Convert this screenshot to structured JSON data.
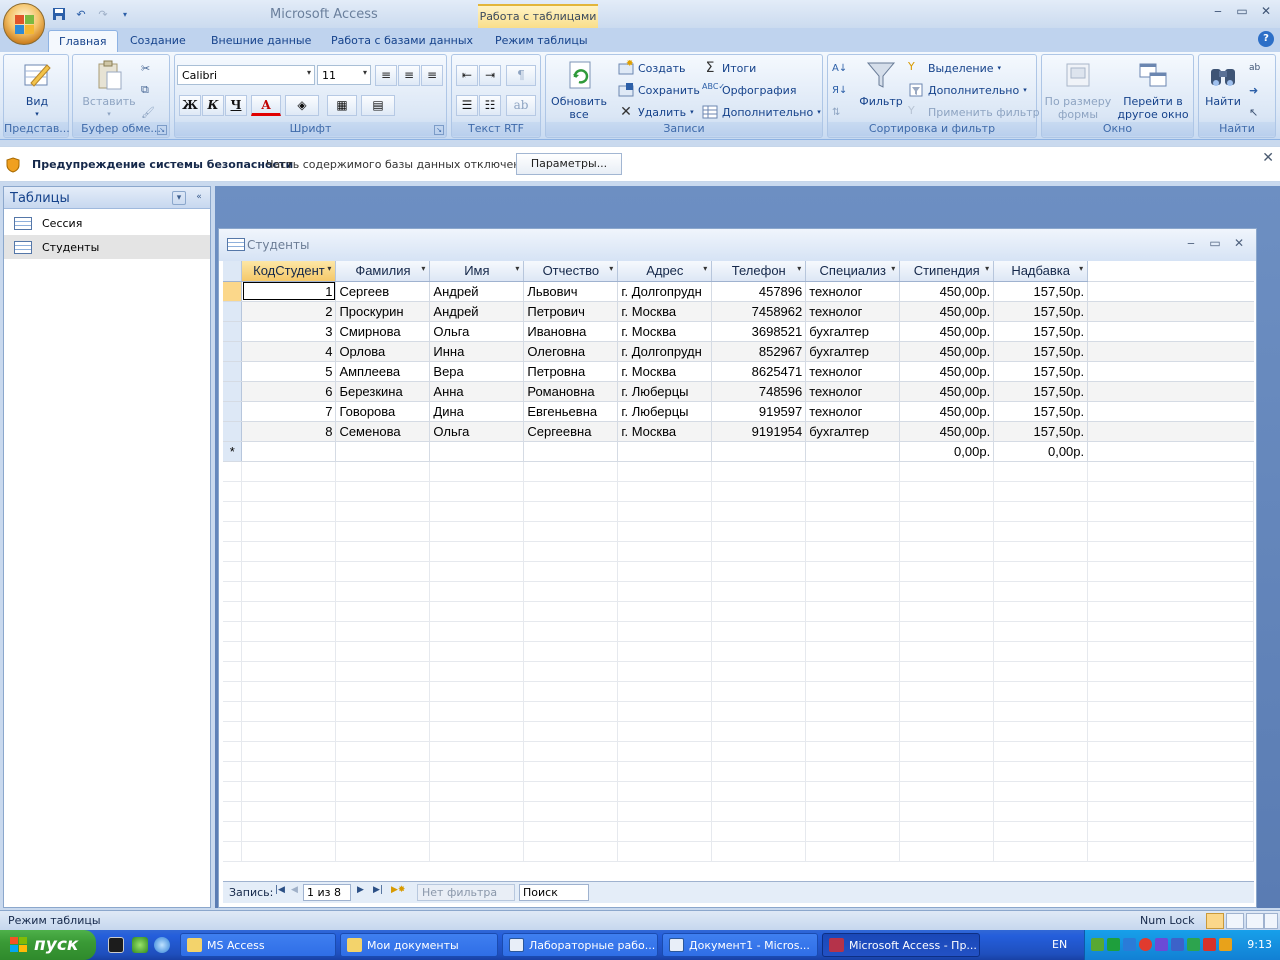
{
  "app": {
    "title": "Microsoft Access",
    "context_tab_title": "Работа с таблицами"
  },
  "tabs": [
    "Главная",
    "Создание",
    "Внешние данные",
    "Работа с базами данных",
    "Режим таблицы"
  ],
  "ribbon": {
    "views": {
      "view_label": "Вид",
      "group_label": "Представ..."
    },
    "clipboard": {
      "paste_label": "Вставить",
      "group_label": "Буфер обме..."
    },
    "font": {
      "font_name": "Calibri",
      "font_size": "11",
      "bold": "Ж",
      "italic": "К",
      "underline": "Ч",
      "font_color": "A",
      "group_label": "Шрифт"
    },
    "rtf": {
      "group_label": "Текст RTF"
    },
    "records": {
      "refresh_label": "Обновить все",
      "new_label": "Создать",
      "save_label": "Сохранить",
      "delete_label": "Удалить",
      "totals_label": "Итоги",
      "spelling_label": "Орфография",
      "more_label": "Дополнительно",
      "group_label": "Записи"
    },
    "sort_filter": {
      "filter_label": "Фильтр",
      "selection_label": "Выделение",
      "advanced_label": "Дополнительно",
      "apply_filter_label": "Применить фильтр",
      "group_label": "Сортировка и фильтр"
    },
    "window": {
      "fit_label": "По размеру формы",
      "switch_label": "Перейти в другое окно",
      "group_label": "Окно"
    },
    "find": {
      "find_label": "Найти",
      "group_label": "Найти"
    }
  },
  "security_bar": {
    "title": "Предупреждение системы безопасности",
    "message": "Часть содержимого базы данных отключено",
    "button": "Параметры..."
  },
  "nav_pane": {
    "title": "Таблицы",
    "items": [
      {
        "label": "Сессия",
        "selected": false
      },
      {
        "label": "Студенты",
        "selected": true
      }
    ]
  },
  "document": {
    "title": "Студенты",
    "columns": [
      "КодСтудент",
      "Фамилия",
      "Имя",
      "Отчество",
      "Адрес",
      "Телефон",
      "Специализ",
      "Стипендия",
      "Надбавка"
    ],
    "rows": [
      [
        "1",
        "Сергеев",
        "Андрей",
        "Львович",
        "г. Долгопрудн",
        "457896",
        "технолог",
        "450,00р.",
        "157,50р."
      ],
      [
        "2",
        "Проскурин",
        "Андрей",
        "Петрович",
        "г. Москва",
        "7458962",
        "технолог",
        "450,00р.",
        "157,50р."
      ],
      [
        "3",
        "Смирнова",
        "Ольга",
        "Ивановна",
        "г. Москва",
        "3698521",
        "бухгалтер",
        "450,00р.",
        "157,50р."
      ],
      [
        "4",
        "Орлова",
        "Инна",
        "Олеговна",
        "г. Долгопрудн",
        "852967",
        "бухгалтер",
        "450,00р.",
        "157,50р."
      ],
      [
        "5",
        "Амплеева",
        "Вера",
        "Петровна",
        "г. Москва",
        "8625471",
        "технолог",
        "450,00р.",
        "157,50р."
      ],
      [
        "6",
        "Березкина",
        "Анна",
        "Романовна",
        "г. Люберцы",
        "748596",
        "технолог",
        "450,00р.",
        "157,50р."
      ],
      [
        "7",
        "Говорова",
        "Дина",
        "Евгеньевна",
        "г. Люберцы",
        "919597",
        "технолог",
        "450,00р.",
        "157,50р."
      ],
      [
        "8",
        "Семенова",
        "Ольга",
        "Сергеевна",
        "г. Москва",
        "9191954",
        "бухгалтер",
        "450,00р.",
        "157,50р."
      ]
    ],
    "new_row_marker": "*",
    "new_row_defaults": {
      "stipend": "0,00р.",
      "bonus": "0,00р."
    },
    "record_nav": {
      "label": "Запись:",
      "counter": "1 из 8",
      "filter_status": "Нет фильтра",
      "search_placeholder": "Поиск"
    }
  },
  "status_bar": {
    "left": "Режим таблицы",
    "numlock": "Num Lock"
  },
  "taskbar": {
    "start": "пуск",
    "tasks": [
      {
        "label": "MS Access",
        "active": false
      },
      {
        "label": "Мои документы",
        "active": false
      },
      {
        "label": "Лабораторные рабо...",
        "active": false
      },
      {
        "label": "Документ1 - Micros...",
        "active": false
      },
      {
        "label": "Microsoft Access - Пр...",
        "active": true
      }
    ],
    "lang": "EN",
    "clock": "9:13"
  },
  "colors": {
    "accent": "#15428b",
    "ribbon_bg": "#dbe7f6",
    "selected_cell": "#fbd78a",
    "taskbar": "#245edb",
    "start": "#3a9a36"
  }
}
